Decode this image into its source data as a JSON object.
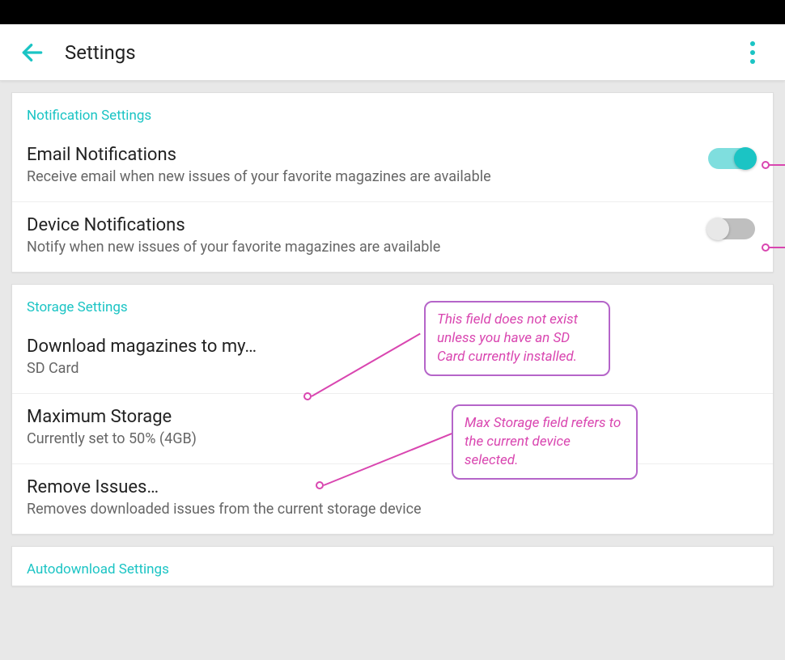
{
  "app_bar": {
    "title": "Settings"
  },
  "sections": {
    "notifications": {
      "header": "Notification Settings",
      "email": {
        "title": "Email Notifications",
        "subtitle": "Receive email when new issues of your favorite magazines are available",
        "enabled": true
      },
      "device": {
        "title": "Device Notifications",
        "subtitle": "Notify when new issues of your favorite magazines are available",
        "enabled": false
      }
    },
    "storage": {
      "header": "Storage Settings",
      "download_location": {
        "title": "Download magazines to my…",
        "subtitle": "SD Card"
      },
      "max_storage": {
        "title": "Maximum Storage",
        "subtitle": "Currently set to 50% (4GB)"
      },
      "remove_issues": {
        "title": "Remove Issues…",
        "subtitle": "Removes downloaded issues from the current storage device"
      }
    },
    "autodownload": {
      "header": "Autodownload Settings"
    }
  },
  "annotations": {
    "callout1": "This field does not exist unless you have an SD Card currently installed.",
    "callout2": "Max Storage field refers to the current device selected."
  }
}
